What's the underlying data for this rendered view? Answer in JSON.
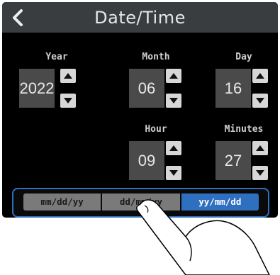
{
  "header": {
    "title": "Date/Time",
    "back_icon": "chevron-left-icon"
  },
  "fields": {
    "year": {
      "label": "Year",
      "value": "2022"
    },
    "month": {
      "label": "Month",
      "value": "06"
    },
    "day": {
      "label": "Day",
      "value": "16"
    },
    "hour": {
      "label": "Hour",
      "value": "09"
    },
    "minutes": {
      "label": "Minutes",
      "value": "27"
    }
  },
  "format": {
    "options": [
      "mm/dd/yy",
      "dd/mm/yy",
      "yy/mm/dd"
    ],
    "selected": "yy/mm/dd"
  },
  "colors": {
    "accent": "#2f6fc0",
    "header_bg": "#3a3d3f",
    "value_bg": "#4a4a4a"
  },
  "icons": {
    "increment": "triangle-up-icon",
    "decrement": "triangle-down-icon",
    "hand": "pointing-hand-icon"
  }
}
